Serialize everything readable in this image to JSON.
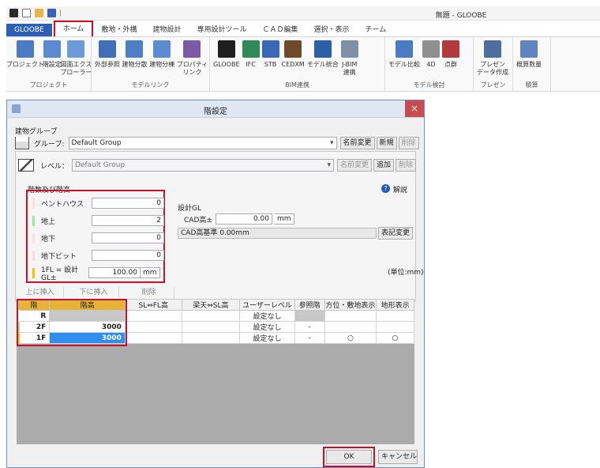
{
  "window": {
    "title": "無題 - GLOOBE"
  },
  "ribbon": {
    "tabs": [
      "GLOOBE",
      "ホーム",
      "敷地・外構",
      "建物設計",
      "専用設計ツール",
      "ＣＡＤ編集",
      "選択・表示",
      "チーム"
    ],
    "groups": [
      {
        "label": "プロジェクト",
        "items": [
          "プロジェクト",
          "階設定",
          "図面エクス\nプローラー"
        ]
      },
      {
        "label": "モデルリンク",
        "items": [
          "外部参照",
          "建物分散",
          "建物分棟",
          "プロパティ\nリンク"
        ]
      },
      {
        "label": "BIM連携",
        "items": [
          "GLOOBE",
          "IFC",
          "STB",
          "CEDXM",
          "モデル統合",
          "J-BIM\n連携"
        ]
      },
      {
        "label": "モデル検討",
        "items": [
          "モデル比較",
          "4D",
          "点群"
        ]
      },
      {
        "label": "プレゼン",
        "items": [
          "プレゼン\nデータ作成"
        ]
      },
      {
        "label": "積算",
        "items": [
          "概算数量"
        ]
      }
    ],
    "icon_colors": [
      "#4a7cc4",
      "#5a8ad0",
      "#6b9bd9",
      "#3f6fb8",
      "#4c7fc6",
      "#5b8cd1",
      "#7a5aa6",
      "#1f1f1f",
      "#2e8b57",
      "#3a68b5",
      "#6d4a2a",
      "#2c5fa8",
      "#7f8fa8",
      "#4a7cc4",
      "#8f8f8f",
      "#b33a3a",
      "#4e6ea0",
      "#5f84c0"
    ]
  },
  "dialog": {
    "title": "階設定",
    "close_icon": "×",
    "building_group": {
      "label": "建物グループ",
      "group_label": "グループ:",
      "group_value": "Default Group",
      "buttons": [
        "名前変更",
        "新規",
        "削除"
      ]
    },
    "level": {
      "label": "レベル：",
      "value": "Default Group",
      "buttons": [
        "名前変更",
        "追加",
        "削除"
      ]
    },
    "floors": {
      "label": "階数及び階高",
      "rows": [
        {
          "label": "ペントハウス",
          "value": "0",
          "color": "#fbe0e0"
        },
        {
          "label": "地上",
          "value": "2",
          "color": "#9de89a"
        },
        {
          "label": "地下",
          "value": "0",
          "color": "#fbe0e0"
        },
        {
          "label": "地下ピット",
          "value": "0",
          "color": "#fbe0e0"
        },
        {
          "label": "1FL = 設計GL±",
          "value": "100.00",
          "unit": "mm",
          "color": "#f3c400"
        }
      ]
    },
    "help": {
      "label": "解説"
    },
    "design_gl": {
      "label": "設計GL",
      "cad_label": "CAD高±",
      "cad_value": "0.00",
      "cad_unit": "mm",
      "ref_text": "CAD高基準  0.00mm",
      "change_button": "表記変更"
    },
    "unit_note": "(単位:mm)",
    "toolbar": [
      "上に挿入",
      "下に挿入",
      "削除"
    ],
    "table": {
      "headers": [
        "階",
        "階高",
        "SL⇔FL高",
        "梁天⇔SL高",
        "ユーザーレベル",
        "参照階",
        "方位・敷地表示",
        "地形表示"
      ],
      "rows": [
        {
          "floor": "R",
          "height": "",
          "sl": "",
          "beam": "",
          "user": "設定なし",
          "ref": "",
          "north": "",
          "terrain": "",
          "color": "#ffffff"
        },
        {
          "floor": "2F",
          "height": "3000",
          "sl": "",
          "beam": "",
          "user": "設定なし",
          "ref": "-",
          "north": "",
          "terrain": "",
          "color": "#9de89a"
        },
        {
          "floor": "1F",
          "height": "3000",
          "sl": "",
          "beam": "",
          "user": "設定なし",
          "ref": "-",
          "north": "○",
          "terrain": "○",
          "color": "#f3c400"
        }
      ]
    },
    "ok": "OK",
    "cancel": "キャンセル"
  }
}
